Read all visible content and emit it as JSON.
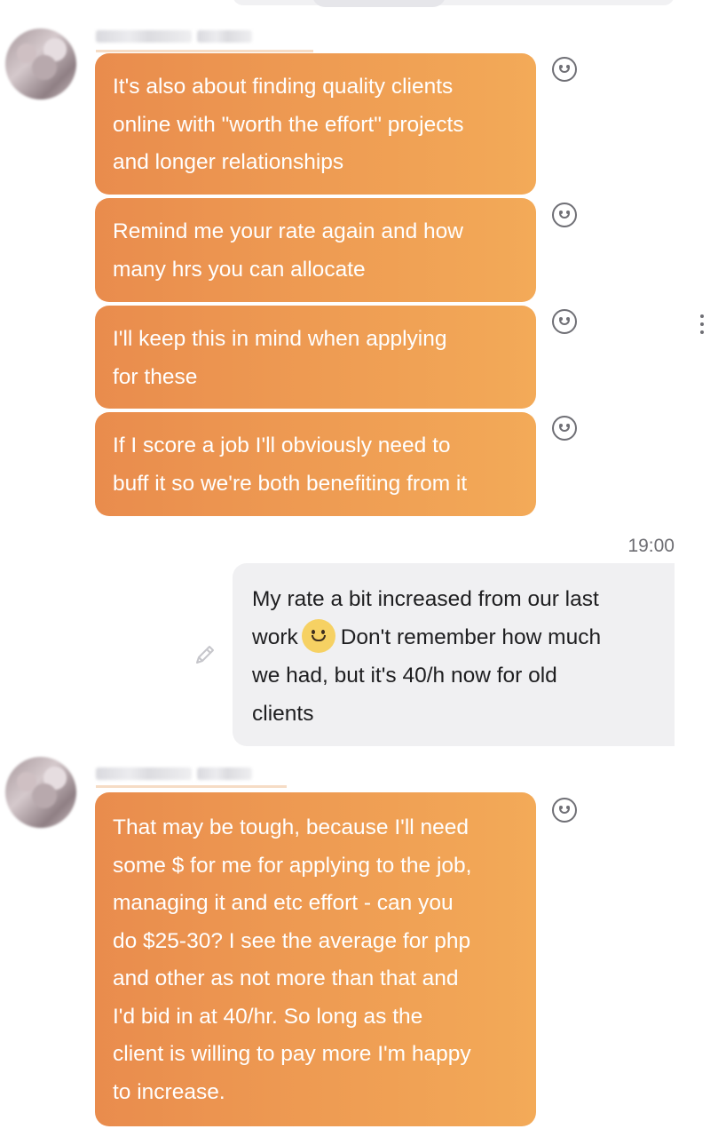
{
  "timestamp": "19:00",
  "incoming_group_1": [
    {
      "text": "It's also about finding quality clients\nonline with \"worth the effort\" projects\nand longer relationships"
    },
    {
      "text": "Remind me your rate again and how\nmany hrs you can allocate"
    },
    {
      "text": "I'll keep this in mind when applying\nfor these"
    },
    {
      "text": "If I score a job I'll obviously need to\nbuff it so we're both benefiting from it"
    }
  ],
  "outgoing_message": {
    "part1": "My rate a bit increased from our last",
    "part2": "work",
    "part3": "Don't remember how much",
    "part4": "we had, but it's 40/h now for old",
    "part5": "clients",
    "emoji": "slightly-smiling-face"
  },
  "incoming_group_2": [
    {
      "text": "That may be tough, because I'll need\nsome $ for me for applying to the job,\nmanaging it and etc effort - can you\ndo $25-30? I see the average for php\nand other as not more than that and\nI'd bid in at 40/hr. So long as the\nclient is willing to pay more I'm happy\nto increase."
    }
  ],
  "icons": {
    "reaction": "smile-reaction-icon",
    "edit": "pencil-icon",
    "menu": "more-vertical-icon"
  },
  "colors": {
    "incoming_bubble_start": "#e98c4d",
    "incoming_bubble_end": "#f3aa58",
    "outgoing_bubble": "#f0f0f2",
    "timestamp": "#6d6d72"
  }
}
